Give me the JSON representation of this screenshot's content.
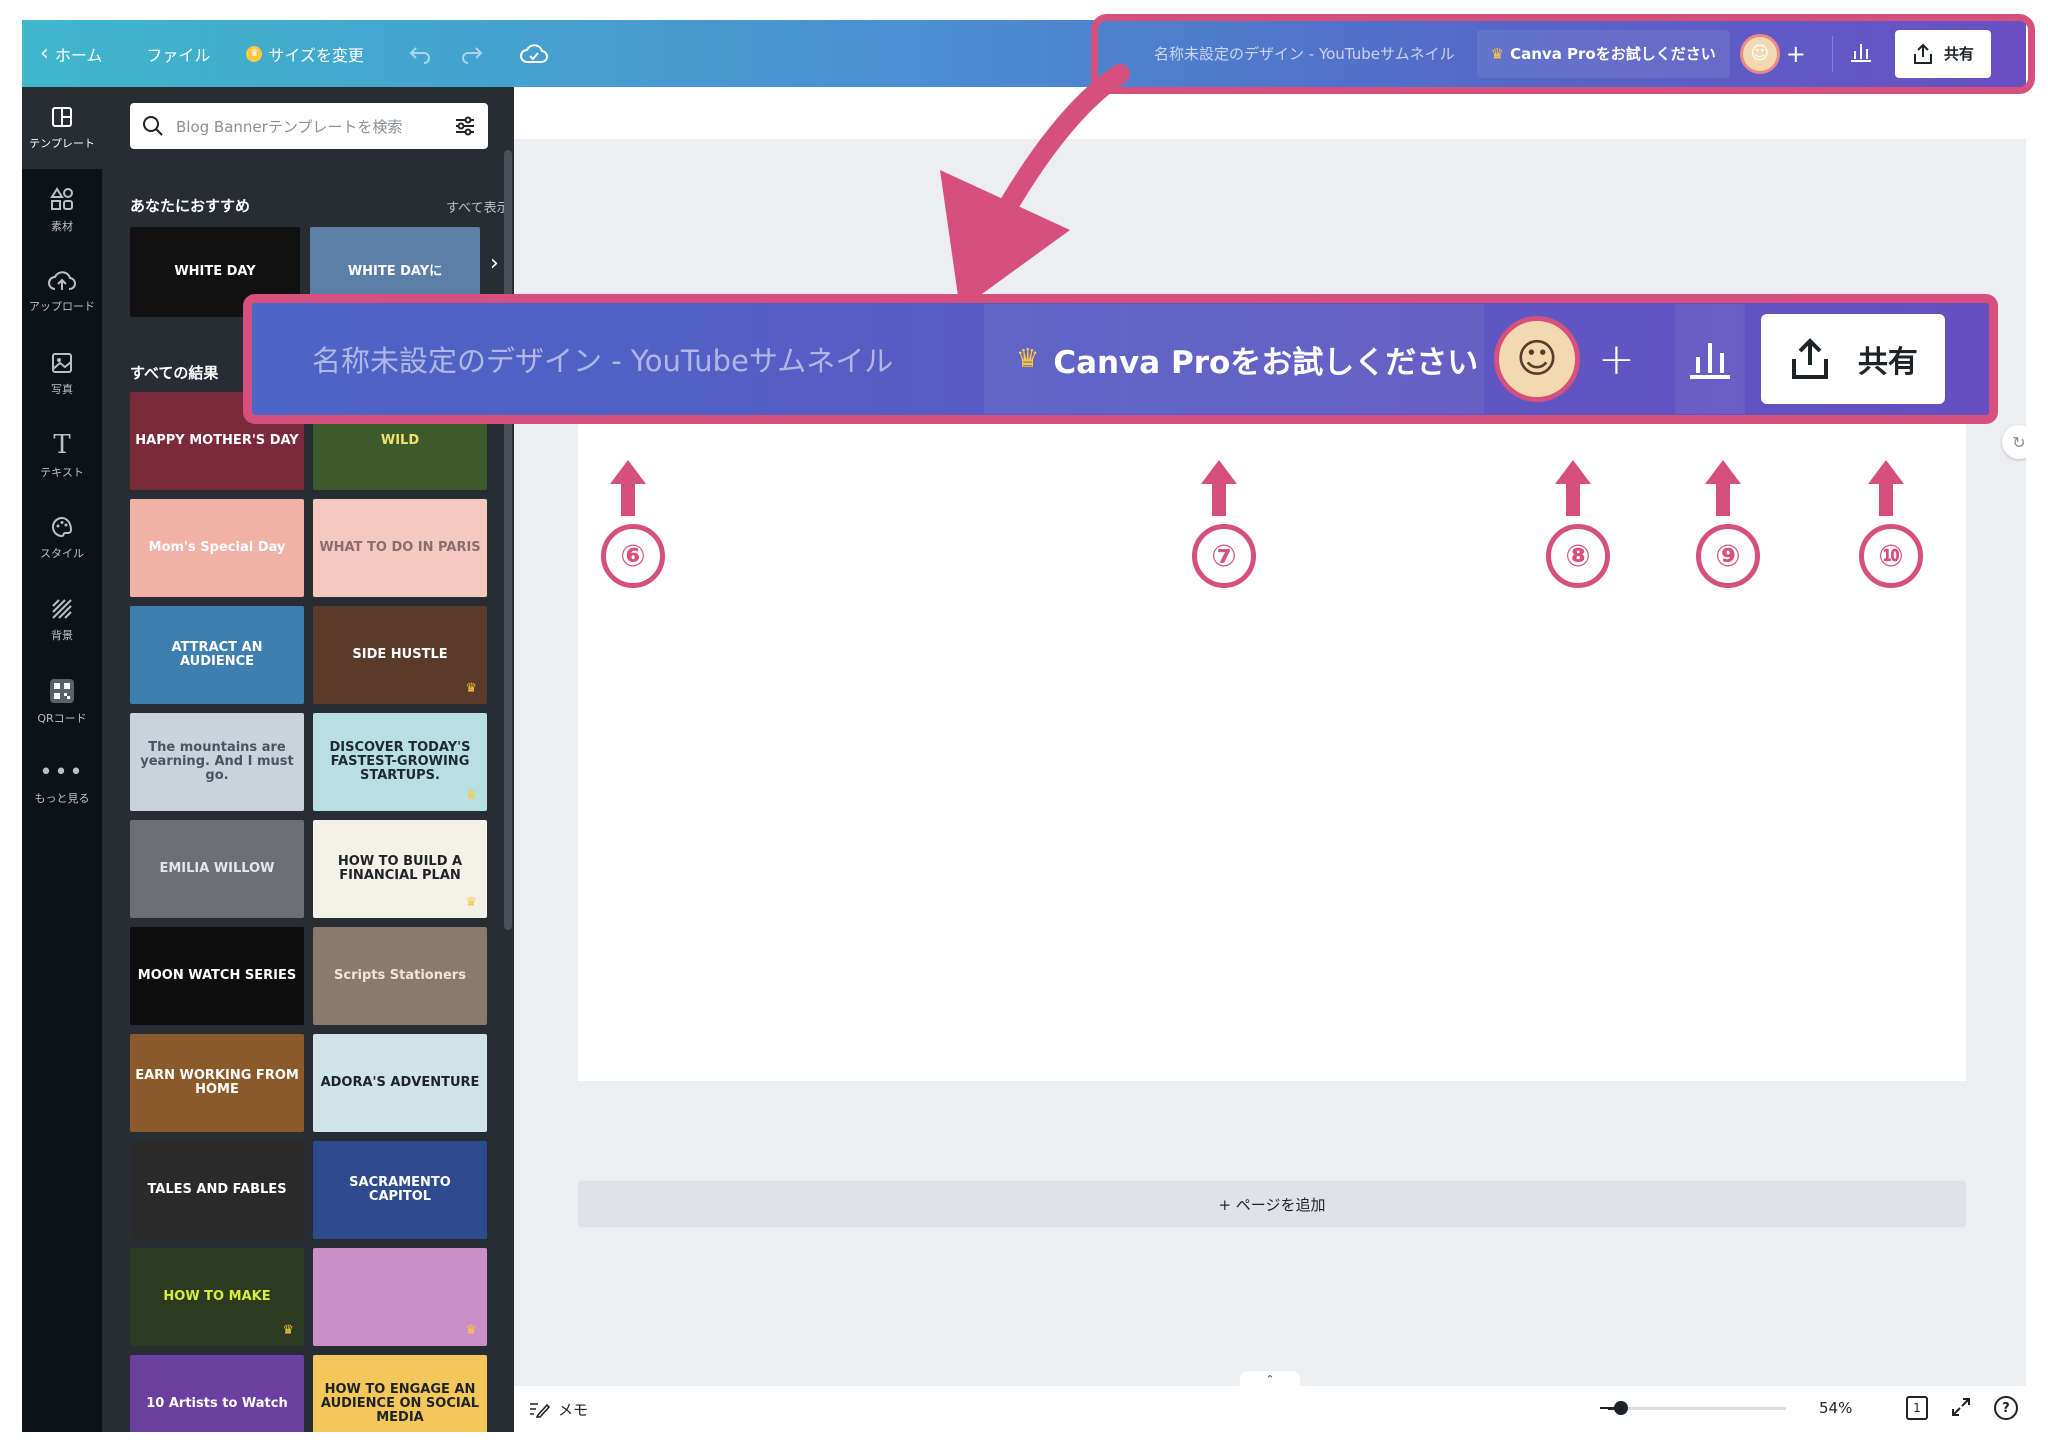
{
  "topbar": {
    "home_label": "ホーム",
    "file_label": "ファイル",
    "resize_label": "サイズを変更",
    "design_title": "名称未設定のデザイン - YouTubeサムネイル",
    "pro_label": "Canva Proをお試しください",
    "share_label": "共有"
  },
  "sidebar": {
    "items": [
      {
        "label": "テンプレート",
        "icon": "template-icon"
      },
      {
        "label": "素材",
        "icon": "elements-icon"
      },
      {
        "label": "アップロード",
        "icon": "upload-icon"
      },
      {
        "label": "写真",
        "icon": "photo-icon"
      },
      {
        "label": "テキスト",
        "icon": "text-icon"
      },
      {
        "label": "スタイル",
        "icon": "palette-icon"
      },
      {
        "label": "背景",
        "icon": "background-icon"
      },
      {
        "label": "QRコード",
        "icon": "qr-code-icon"
      },
      {
        "label": "もっと見る",
        "icon": "more-icon"
      }
    ]
  },
  "panel": {
    "search_placeholder": "Blog Bannerテンプレートを検索",
    "recommended_title": "あなたにおすすめ",
    "see_all": "すべて表示",
    "results_title": "すべての結果",
    "recommended": [
      {
        "text": "WHITE DAY",
        "bg": "#111111",
        "fg": "#ffffff"
      },
      {
        "text": "WHITE DAYに",
        "bg": "#5b7fa6",
        "fg": "#ffffff"
      }
    ],
    "templates": [
      {
        "text": "HAPPY MOTHER'S DAY",
        "bg": "#7a2a3a",
        "fg": "#ffffff",
        "pro": false
      },
      {
        "text": "WILD",
        "bg": "#3d5a2a",
        "fg": "#f3e26b",
        "pro": false
      },
      {
        "text": "Mom's Special Day",
        "bg": "#f0b2a5",
        "fg": "#ffffff",
        "pro": false
      },
      {
        "text": "WHAT TO DO IN PARIS",
        "bg": "#f3c9c0",
        "fg": "#8a6d70",
        "pro": false
      },
      {
        "text": "ATTRACT AN AUDIENCE",
        "bg": "#3f7fb0",
        "fg": "#ffffff",
        "pro": false
      },
      {
        "text": "SIDE HUSTLE",
        "bg": "#5a3a28",
        "fg": "#ffffff",
        "pro": true
      },
      {
        "text": "The mountains are yearning. And I must go.",
        "bg": "#c9d3dc",
        "fg": "#4a5560",
        "pro": false
      },
      {
        "text": "DISCOVER TODAY'S FASTEST-GROWING STARTUPS.",
        "bg": "#b8e0e3",
        "fg": "#1e2a30",
        "pro": true
      },
      {
        "text": "EMILIA WILLOW",
        "bg": "#6c7074",
        "fg": "#e6e6e6",
        "pro": false
      },
      {
        "text": "HOW TO BUILD A FINANCIAL PLAN",
        "bg": "#f4f1e8",
        "fg": "#1e2328",
        "pro": true
      },
      {
        "text": "MOON WATCH SERIES",
        "bg": "#0e0e0e",
        "fg": "#ffffff",
        "pro": false
      },
      {
        "text": "Scripts Stationers",
        "bg": "#8a7a6a",
        "fg": "#efe6da",
        "pro": false
      },
      {
        "text": "EARN WORKING FROM HOME",
        "bg": "#8a5a2a",
        "fg": "#ffffff",
        "pro": false
      },
      {
        "text": "ADORA'S ADVENTURE",
        "bg": "#cfe3e8",
        "fg": "#1e2328",
        "pro": false
      },
      {
        "text": "TALES AND FABLES",
        "bg": "#2a2a2a",
        "fg": "#ffffff",
        "pro": false
      },
      {
        "text": "SACRAMENTO CAPITOL",
        "bg": "#2e4b8f",
        "fg": "#ffffff",
        "pro": false
      },
      {
        "text": "HOW TO MAKE",
        "bg": "#2d3a22",
        "fg": "#d8ef3a",
        "pro": true
      },
      {
        "text": "",
        "bg": "#c98fc6",
        "fg": "#ffffff",
        "pro": true
      },
      {
        "text": "10 Artists to Watch",
        "bg": "#6a3fa0",
        "fg": "#ffffff",
        "pro": false
      },
      {
        "text": "HOW TO ENGAGE AN AUDIENCE ON SOCIAL MEDIA",
        "bg": "#f4c75a",
        "fg": "#1e2328",
        "pro": true
      }
    ]
  },
  "canvas": {
    "add_page": "+ ページを追加",
    "notes_label": "メモ",
    "zoom": "54%",
    "page_count": "1"
  },
  "annotations": {
    "callout_numbers": [
      "⑥",
      "⑦",
      "⑧",
      "⑨",
      "⑩"
    ],
    "accent": "#d6507e"
  }
}
